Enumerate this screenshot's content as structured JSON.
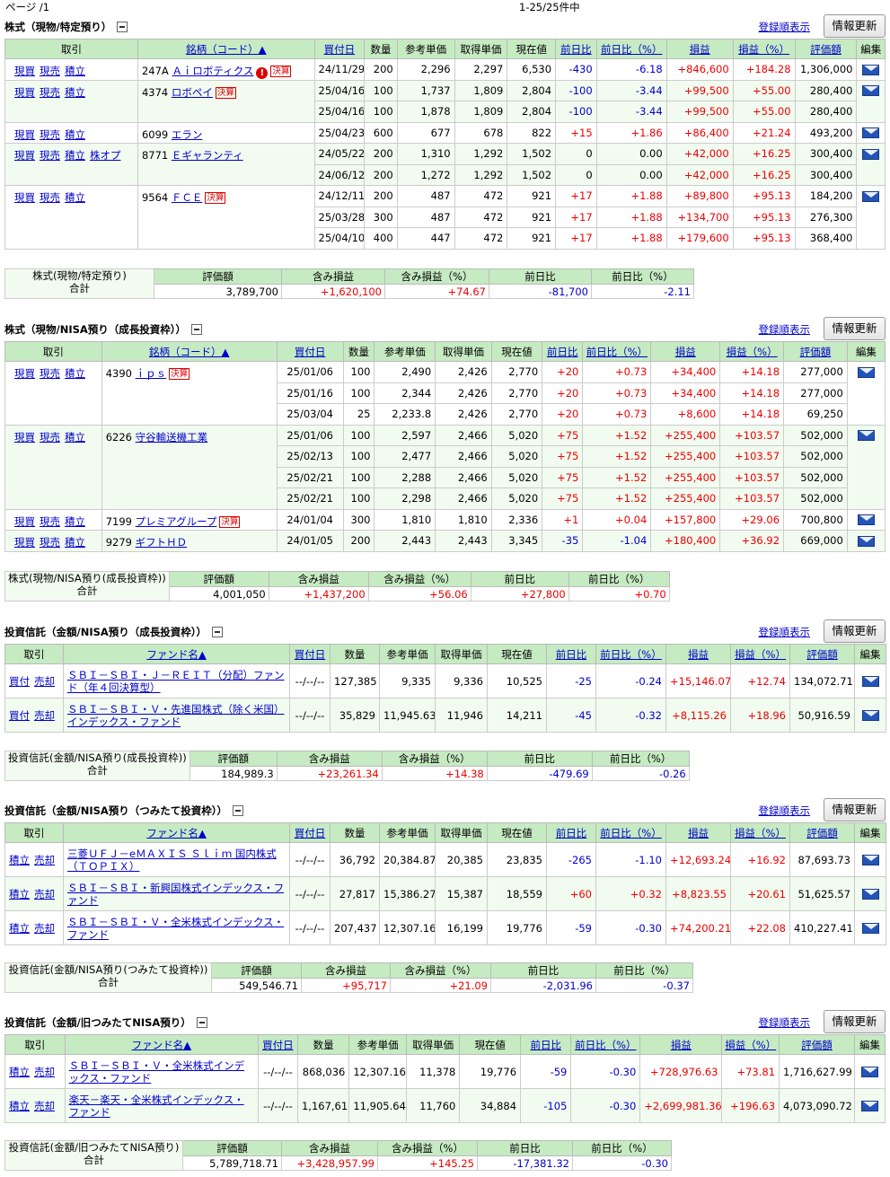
{
  "top": {
    "page": "ページ /1",
    "count": "1-25/25件中"
  },
  "common": {
    "reg_order": "登録順表示",
    "refresh": "情報更新",
    "badge": "決算",
    "total": "合計",
    "dash_date": "--/--/--"
  },
  "s1": {
    "title": "株式（現物/特定預り）",
    "headers": [
      "取引",
      "銘柄（コード）▲",
      "買付日",
      "数量",
      "参考単価",
      "取得単価",
      "現在値",
      "前日比",
      "前日比（%）",
      "損益",
      "損益（%）",
      "評価額",
      "編集"
    ],
    "rows": [
      {
        "a": [
          "現買",
          "現売",
          "積立"
        ],
        "code": "247A",
        "name": "Ａｉロボティクス",
        "warn": "!",
        "badge": true,
        "date": "24/11/29",
        "qty": "200",
        "ref": "2,296",
        "acq": "2,297",
        "cur": "6,530",
        "chg": "-430",
        "chgp": "-6.18",
        "pl": "+846,600",
        "plp": "+184.28",
        "val": "1,306,000",
        "cls": "w",
        "mail": true
      },
      {
        "a": [
          "現買",
          "現売",
          "積立"
        ],
        "code": "4374",
        "name": "ロボペイ",
        "badge": true,
        "date": "25/04/16",
        "qty": "100",
        "ref": "1,737",
        "acq": "1,809",
        "cur": "2,804",
        "chg": "-100",
        "chgp": "-3.44",
        "pl": "+99,500",
        "plp": "+55.00",
        "val": "280,400",
        "cls": "g",
        "mail": true
      },
      {
        "date": "25/04/16",
        "qty": "100",
        "ref": "1,878",
        "acq": "1,809",
        "cur": "2,804",
        "chg": "-100",
        "chgp": "-3.44",
        "pl": "+99,500",
        "plp": "+55.00",
        "val": "280,400",
        "cls": "g"
      },
      {
        "a": [
          "現買",
          "現売",
          "積立"
        ],
        "code": "6099",
        "name": "エラン",
        "date": "25/04/23",
        "qty": "600",
        "ref": "677",
        "acq": "678",
        "cur": "822",
        "chg": "+15",
        "chgp": "+1.86",
        "pl": "+86,400",
        "plp": "+21.24",
        "val": "493,200",
        "cls": "w",
        "mail": true
      },
      {
        "a": [
          "現買",
          "現売",
          "積立",
          "株オプ"
        ],
        "code": "8771",
        "name": "Ｅギャランティ",
        "date": "24/05/22",
        "qty": "200",
        "ref": "1,310",
        "acq": "1,292",
        "cur": "1,502",
        "chg": "0",
        "chgp": "0.00",
        "pl": "+42,000",
        "plp": "+16.25",
        "val": "300,400",
        "cls": "g",
        "mail": true
      },
      {
        "date": "24/06/12",
        "qty": "200",
        "ref": "1,272",
        "acq": "1,292",
        "cur": "1,502",
        "chg": "0",
        "chgp": "0.00",
        "pl": "+42,000",
        "plp": "+16.25",
        "val": "300,400",
        "cls": "g"
      },
      {
        "a": [
          "現買",
          "現売",
          "積立"
        ],
        "code": "9564",
        "name": "ＦＣＥ",
        "badge": true,
        "date": "24/12/11",
        "qty": "200",
        "ref": "487",
        "acq": "472",
        "cur": "921",
        "chg": "+17",
        "chgp": "+1.88",
        "pl": "+89,800",
        "plp": "+95.13",
        "val": "184,200",
        "cls": "w",
        "mail": true
      },
      {
        "date": "25/03/28",
        "qty": "300",
        "ref": "487",
        "acq": "472",
        "cur": "921",
        "chg": "+17",
        "chgp": "+1.88",
        "pl": "+134,700",
        "plp": "+95.13",
        "val": "276,300",
        "cls": "w"
      },
      {
        "date": "25/04/10",
        "qty": "400",
        "ref": "447",
        "acq": "472",
        "cur": "921",
        "chg": "+17",
        "chgp": "+1.88",
        "pl": "+179,600",
        "plp": "+95.13",
        "val": "368,400",
        "cls": "w"
      }
    ],
    "summary": {
      "label": "株式(現物/特定預り)",
      "headers": [
        "評価額",
        "含み損益",
        "含み損益（%）",
        "前日比",
        "前日比（%）"
      ],
      "values": [
        "3,789,700",
        "+1,620,100",
        "+74.67",
        "-81,700",
        "-2.11"
      ]
    }
  },
  "s2": {
    "title": "株式（現物/NISA預り（成長投資枠））",
    "rows": [
      {
        "a": [
          "現買",
          "現売",
          "積立"
        ],
        "code": "4390",
        "name": "ｉｐｓ",
        "badge": true,
        "date": "25/01/06",
        "qty": "100",
        "ref": "2,490",
        "acq": "2,426",
        "cur": "2,770",
        "chg": "+20",
        "chgp": "+0.73",
        "pl": "+34,400",
        "plp": "+14.18",
        "val": "277,000",
        "cls": "w",
        "mail": true
      },
      {
        "date": "25/01/16",
        "qty": "100",
        "ref": "2,344",
        "acq": "2,426",
        "cur": "2,770",
        "chg": "+20",
        "chgp": "+0.73",
        "pl": "+34,400",
        "plp": "+14.18",
        "val": "277,000",
        "cls": "w"
      },
      {
        "date": "25/03/04",
        "qty": "25",
        "ref": "2,233.8",
        "acq": "2,426",
        "cur": "2,770",
        "chg": "+20",
        "chgp": "+0.73",
        "pl": "+8,600",
        "plp": "+14.18",
        "val": "69,250",
        "cls": "w"
      },
      {
        "a": [
          "現買",
          "現売",
          "積立"
        ],
        "code": "6226",
        "name": "守谷輸送機工業",
        "date": "25/01/06",
        "qty": "100",
        "ref": "2,597",
        "acq": "2,466",
        "cur": "5,020",
        "chg": "+75",
        "chgp": "+1.52",
        "pl": "+255,400",
        "plp": "+103.57",
        "val": "502,000",
        "cls": "g",
        "mail": true
      },
      {
        "date": "25/02/13",
        "qty": "100",
        "ref": "2,477",
        "acq": "2,466",
        "cur": "5,020",
        "chg": "+75",
        "chgp": "+1.52",
        "pl": "+255,400",
        "plp": "+103.57",
        "val": "502,000",
        "cls": "g"
      },
      {
        "date": "25/02/21",
        "qty": "100",
        "ref": "2,288",
        "acq": "2,466",
        "cur": "5,020",
        "chg": "+75",
        "chgp": "+1.52",
        "pl": "+255,400",
        "plp": "+103.57",
        "val": "502,000",
        "cls": "g"
      },
      {
        "date": "25/02/21",
        "qty": "100",
        "ref": "2,298",
        "acq": "2,466",
        "cur": "5,020",
        "chg": "+75",
        "chgp": "+1.52",
        "pl": "+255,400",
        "plp": "+103.57",
        "val": "502,000",
        "cls": "g"
      },
      {
        "a": [
          "現買",
          "現売",
          "積立"
        ],
        "code": "7199",
        "name": "プレミアグループ",
        "badge": true,
        "date": "24/01/04",
        "qty": "300",
        "ref": "1,810",
        "acq": "1,810",
        "cur": "2,336",
        "chg": "+1",
        "chgp": "+0.04",
        "pl": "+157,800",
        "plp": "+29.06",
        "val": "700,800",
        "cls": "w",
        "mail": true
      },
      {
        "a": [
          "現買",
          "現売",
          "積立"
        ],
        "code": "9279",
        "name": "ギフトＨＤ",
        "date": "24/01/05",
        "qty": "200",
        "ref": "2,443",
        "acq": "2,443",
        "cur": "3,345",
        "chg": "-35",
        "chgp": "-1.04",
        "pl": "+180,400",
        "plp": "+36.92",
        "val": "669,000",
        "cls": "g",
        "mail": true
      }
    ],
    "summary": {
      "label": "株式(現物/NISA預り(成長投資枠))",
      "values": [
        "4,001,050",
        "+1,437,200",
        "+56.06",
        "+27,800",
        "+0.70"
      ]
    }
  },
  "s3": {
    "title": "投資信託（金額/NISA預り（成長投資枠））",
    "headers": [
      "取引",
      "ファンド名▲",
      "買付日",
      "数量",
      "参考単価",
      "取得単価",
      "現在値",
      "前日比",
      "前日比（%）",
      "損益",
      "損益（%）",
      "評価額",
      "編集"
    ],
    "rows": [
      {
        "a": [
          "買付",
          "売却"
        ],
        "name": "ＳＢＩ－ＳＢＩ・Ｊ－ＲＥＩＴ（分配）ファンド（年４回決算型）",
        "qty": "127,385",
        "ref": "9,335",
        "acq": "9,336",
        "cur": "10,525",
        "chg": "-25",
        "chgp": "-0.24",
        "pl": "+15,146.07",
        "plp": "+12.74",
        "val": "134,072.71",
        "cls": "w"
      },
      {
        "a": [
          "買付",
          "売却"
        ],
        "name": "ＳＢＩ－ＳＢＩ・Ｖ・先進国株式（除く米国）インデックス・ファンド",
        "qty": "35,829",
        "ref": "11,945.63",
        "acq": "11,946",
        "cur": "14,211",
        "chg": "-45",
        "chgp": "-0.32",
        "pl": "+8,115.26",
        "plp": "+18.96",
        "val": "50,916.59",
        "cls": "g"
      }
    ],
    "summary": {
      "label": "投資信託(金額/NISA預り(成長投資枠))",
      "values": [
        "184,989.3",
        "+23,261.34",
        "+14.38",
        "-479.69",
        "-0.26"
      ]
    }
  },
  "s4": {
    "title": "投資信託（金額/NISA預り（つみたて投資枠））",
    "rows": [
      {
        "a": [
          "積立",
          "売却"
        ],
        "name": "三菱ＵＦＪ－eＭＡＸＩＳ Ｓｌｉｍ 国内株式（ＴＯＰＩＸ）",
        "qty": "36,792",
        "ref": "20,384.87",
        "acq": "20,385",
        "cur": "23,835",
        "chg": "-265",
        "chgp": "-1.10",
        "pl": "+12,693.24",
        "plp": "+16.92",
        "val": "87,693.73",
        "cls": "w"
      },
      {
        "a": [
          "積立",
          "売却"
        ],
        "name": "ＳＢＩ－ＳＢＩ・新興国株式インデックス・ファンド",
        "qty": "27,817",
        "ref": "15,386.27",
        "acq": "15,387",
        "cur": "18,559",
        "chg": "+60",
        "chgp": "+0.32",
        "pl": "+8,823.55",
        "plp": "+20.61",
        "val": "51,625.57",
        "cls": "g"
      },
      {
        "a": [
          "積立",
          "売却"
        ],
        "name": "ＳＢＩ－ＳＢＩ・Ｖ・全米株式インデックス・ファンド",
        "qty": "207,437",
        "ref": "12,307.16",
        "acq": "16,199",
        "cur": "19,776",
        "chg": "-59",
        "chgp": "-0.30",
        "pl": "+74,200.21",
        "plp": "+22.08",
        "val": "410,227.41",
        "cls": "w"
      }
    ],
    "summary": {
      "label": "投資信託(金額/NISA預り(つみたて投資枠))",
      "values": [
        "549,546.71",
        "+95,717",
        "+21.09",
        "-2,031.96",
        "-0.37"
      ]
    }
  },
  "s5": {
    "title": "投資信託（金額/旧つみたてNISA預り）",
    "rows": [
      {
        "a": [
          "積立",
          "売却"
        ],
        "name": "ＳＢＩ－ＳＢＩ・Ｖ・全米株式インデックス・ファンド",
        "qty": "868,036",
        "ref": "12,307.16",
        "acq": "11,378",
        "cur": "19,776",
        "chg": "-59",
        "chgp": "-0.30",
        "pl": "+728,976.63",
        "plp": "+73.81",
        "val": "1,716,627.99",
        "cls": "w"
      },
      {
        "a": [
          "積立",
          "売却"
        ],
        "name": "楽天－楽天・全米株式インデックス・ファンド",
        "qty": "1,167,610",
        "ref": "11,905.64",
        "acq": "11,760",
        "cur": "34,884",
        "chg": "-105",
        "chgp": "-0.30",
        "pl": "+2,699,981.36",
        "plp": "+196.63",
        "val": "4,073,090.72",
        "cls": "g"
      }
    ],
    "summary": {
      "label": "投資信託(金額/旧つみたてNISA預り)",
      "values": [
        "5,789,718.71",
        "+3,428,957.99",
        "+145.25",
        "-17,381.32",
        "-0.30"
      ]
    }
  }
}
